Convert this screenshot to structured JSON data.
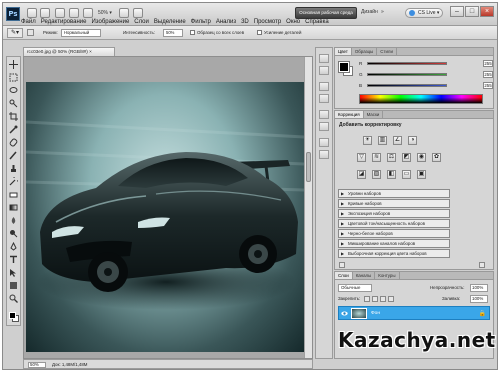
{
  "app": {
    "logo": "Ps",
    "zoom_menu": "50% ▾",
    "workspace_button": "Основная рабочая среда",
    "workspace_design": "Дизайн",
    "workspace_more": "»",
    "cs_live": "CS Live ▾",
    "window_buttons": [
      "–",
      "□",
      "×"
    ]
  },
  "menu": [
    "Файл",
    "Редактирование",
    "Изображение",
    "Слои",
    "Выделение",
    "Фильтр",
    "Анализ",
    "3D",
    "Просмотр",
    "Окно",
    "Справка"
  ],
  "options_bar": {
    "mode_label": "Режим:",
    "mode_value": "Нормальный",
    "tolerance_label": "Интенсивность:",
    "tolerance_value": "50%",
    "check1": "Образец со всех слоев",
    "check2": "Усиление деталей"
  },
  "document": {
    "tab_title": "rcc03e0.jpg @ 50% (RGB/8#) ×",
    "status_zoom": "50%",
    "status_doc": "Док: 1,48M/1,48M"
  },
  "color_panel": {
    "tabs": [
      "Цвет",
      "Образцы",
      "Стили"
    ],
    "channels": [
      {
        "label": "R",
        "value": "255",
        "color": "#d33b3b"
      },
      {
        "label": "G",
        "value": "255",
        "color": "#3ea33e"
      },
      {
        "label": "B",
        "value": "255",
        "color": "#3b59d3"
      }
    ]
  },
  "adjustments_panel": {
    "tabs": [
      "Коррекция",
      "Маски"
    ],
    "title": "Добавить корректировку",
    "presets": [
      "Уровни наборов",
      "Кривые наборов",
      "Экспозиция наборов",
      "Цветовой тон/насыщенность наборов",
      "Черно-белое наборов",
      "Микширование каналов наборов",
      "Выборочная коррекция цвета наборов"
    ]
  },
  "layers_panel": {
    "tabs": [
      "Слои",
      "Каналы",
      "Контуры"
    ],
    "blend_mode": "Обычные",
    "opacity_label": "Непрозрачность:",
    "opacity_value": "100%",
    "lock_label": "Закрепить:",
    "fill_label": "Заливка:",
    "fill_value": "100%",
    "layer_name": "Фон",
    "selected_color": "#3aa6e8"
  },
  "watermark": "Kazachya.net"
}
